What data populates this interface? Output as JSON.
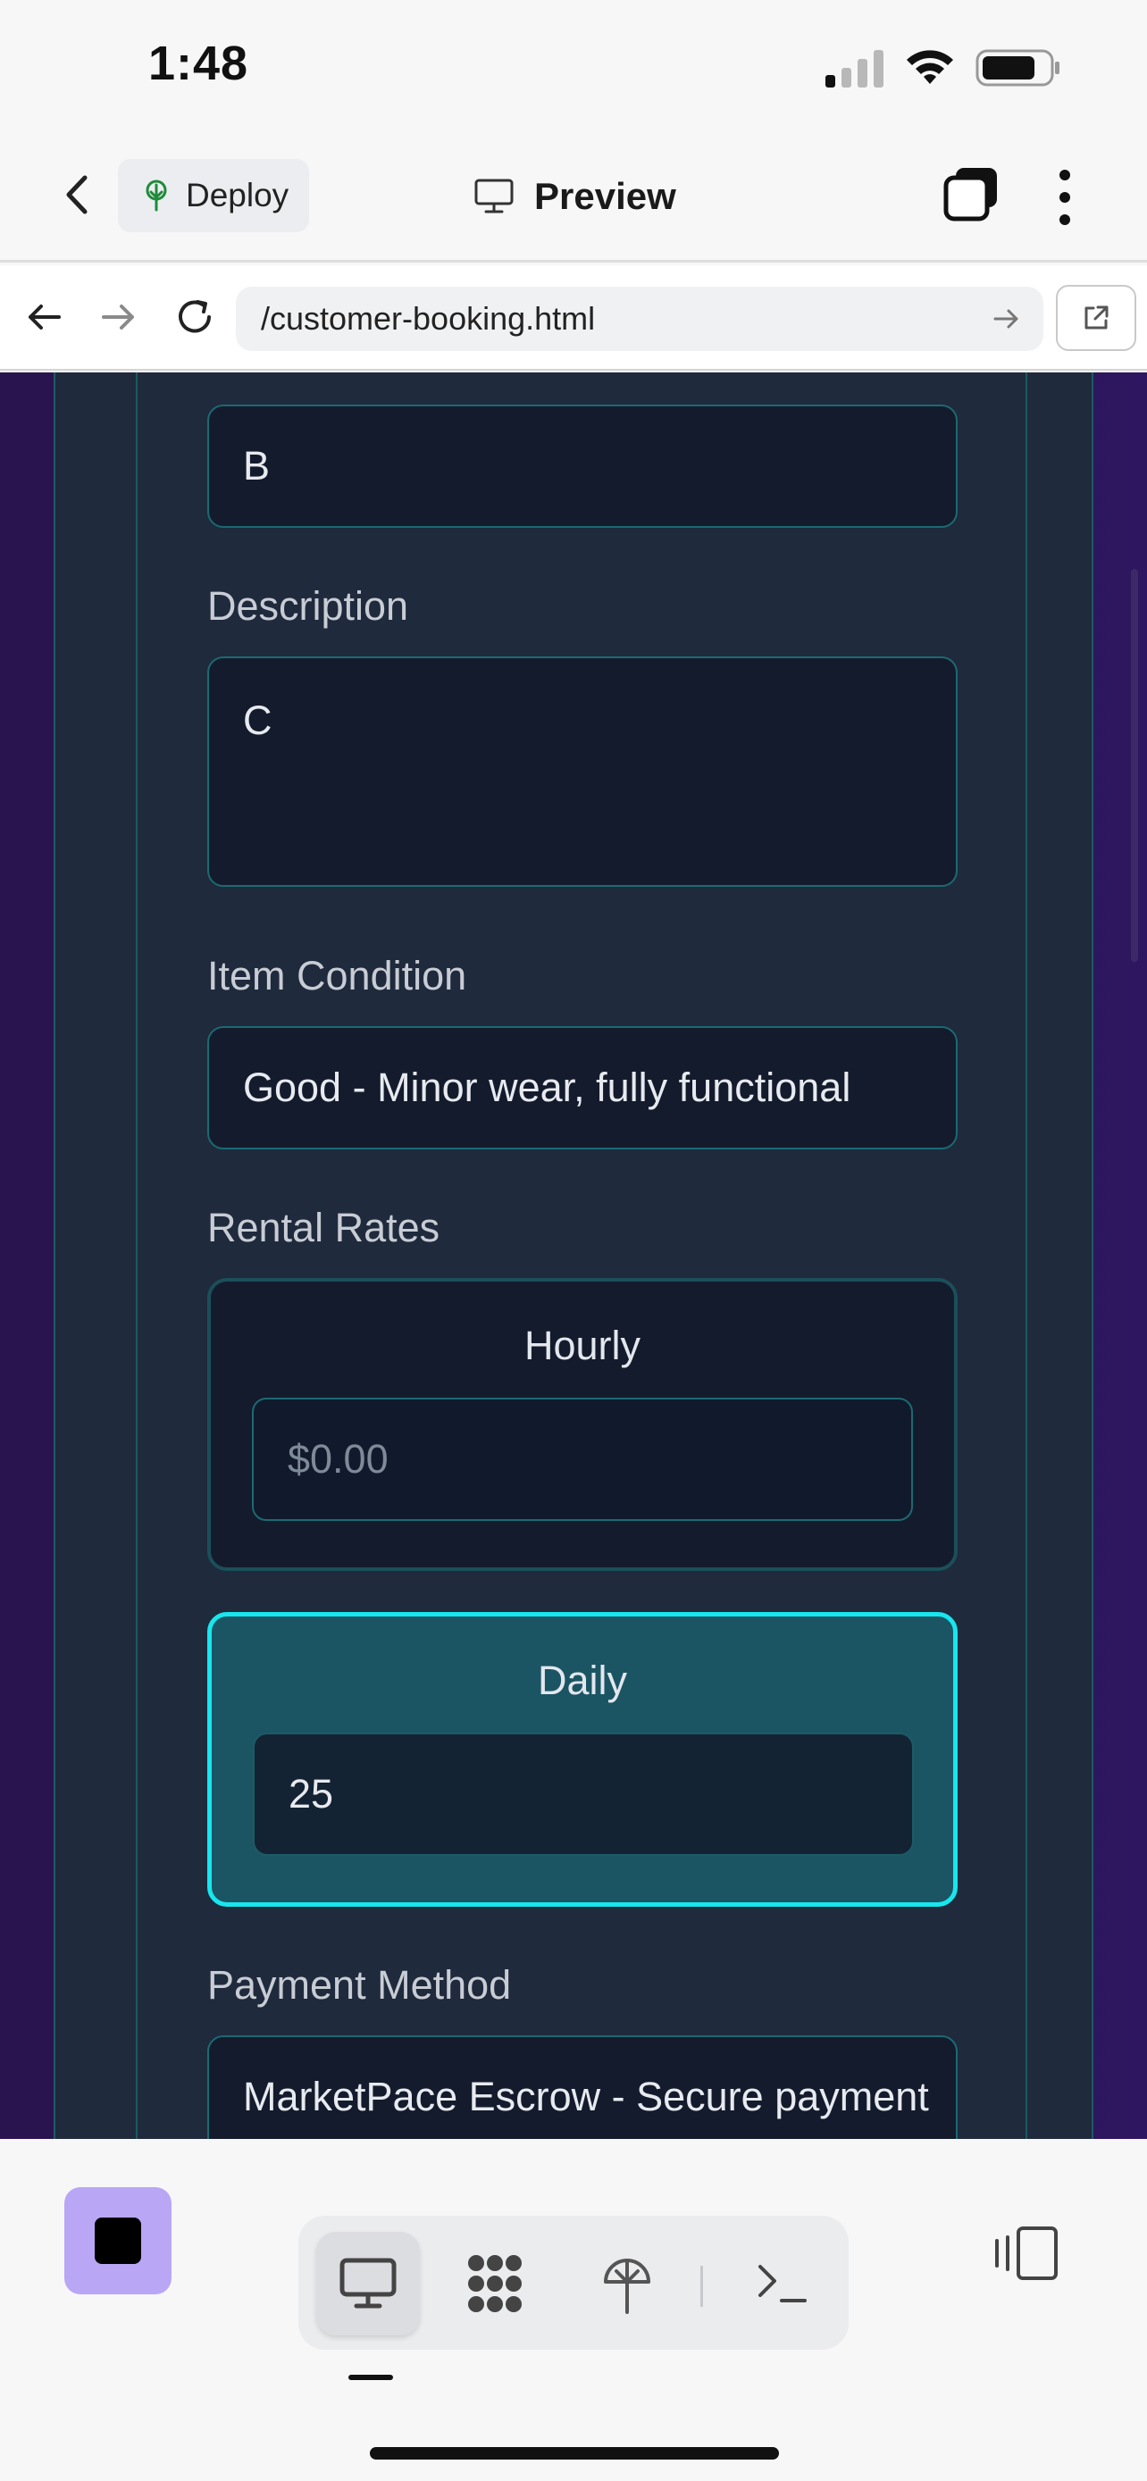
{
  "status_bar": {
    "time": "1:48"
  },
  "header": {
    "deploy_label": "Deploy",
    "title": "Preview"
  },
  "url_bar": {
    "url": "/customer-booking.html"
  },
  "form": {
    "title_value": "B",
    "description_label": "Description",
    "description_value": "C",
    "condition_label": "Item Condition",
    "condition_value": "Good - Minor wear, fully functional",
    "rental_rates_label": "Rental Rates",
    "hourly": {
      "label": "Hourly",
      "placeholder": "$0.00",
      "value": ""
    },
    "daily": {
      "label": "Daily",
      "value": "25",
      "selected": true
    },
    "payment_label": "Payment Method",
    "payment_value": "MarketPace Escrow - Secure payment"
  },
  "colors": {
    "accent_cyan": "#18e6ee",
    "daily_bg": "#1b5563",
    "card_bg": "#1f2a3d",
    "field_bg": "#141b2d",
    "page_bg_purple": "#2a1450",
    "stop_button": "#b9a6f5"
  },
  "toolbar": {
    "icons": [
      "stop-icon",
      "desktop-preview-icon",
      "ai-agent-icon",
      "deploy-icon",
      "terminal-icon",
      "layout-toggle-icon"
    ]
  }
}
